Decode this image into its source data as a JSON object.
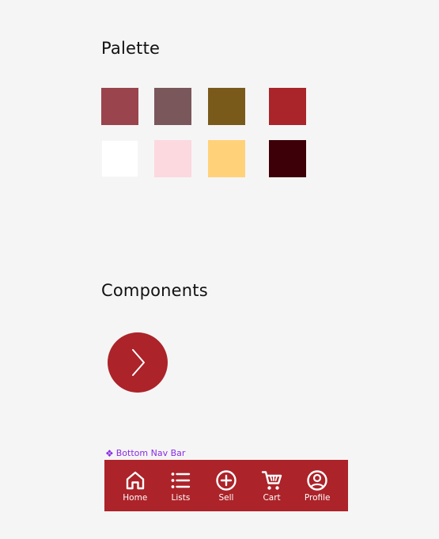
{
  "sections": {
    "palette_title": "Palette",
    "components_title": "Components"
  },
  "palette": {
    "swatches": [
      {
        "name": "rose",
        "color": "#9a444d"
      },
      {
        "name": "mauve",
        "color": "#7a575a"
      },
      {
        "name": "olive-brown",
        "color": "#7a5a1b"
      },
      {
        "name": "crimson",
        "color": "#a9252a"
      },
      {
        "name": "white",
        "color": "#ffffff"
      },
      {
        "name": "light-pink",
        "color": "#fcd8df"
      },
      {
        "name": "honey",
        "color": "#ffd27a"
      },
      {
        "name": "maroon",
        "color": "#3d0008"
      }
    ]
  },
  "components": {
    "fab": {
      "color": "#ac2329",
      "icon": "chevron-right-icon"
    },
    "bottom_nav_caption": "Bottom Nav Bar",
    "bottom_nav_caption_color": "#8a2be2",
    "bottom_nav": {
      "background": "#ac2329",
      "items": [
        {
          "label": "Home",
          "icon": "home-icon"
        },
        {
          "label": "Lists",
          "icon": "list-icon"
        },
        {
          "label": "Sell",
          "icon": "plus-circle-icon"
        },
        {
          "label": "Cart",
          "icon": "cart-icon"
        },
        {
          "label": "Profile",
          "icon": "profile-icon"
        }
      ]
    }
  }
}
